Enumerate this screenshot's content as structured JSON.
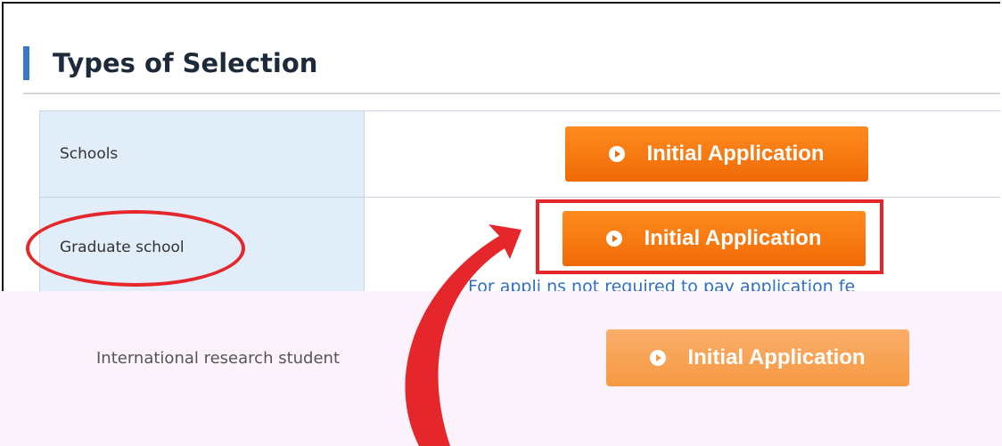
{
  "section": {
    "title": "Types of Selection"
  },
  "rows": [
    {
      "label": "Schools",
      "button": "Initial Application"
    },
    {
      "label": "Graduate school",
      "button": "Initial Application",
      "note": "For appli",
      "note_rest": "ns not required to pay application fe"
    }
  ],
  "overlay": {
    "label": "International research student",
    "button": "Initial Application"
  },
  "colors": {
    "accent": "#f06a06",
    "highlight": "#e5262a",
    "label_bg": "#e1edf9",
    "overlay_bg": "#fcf2fb"
  },
  "icons": {
    "button_icon": "play-circle-icon",
    "note_icon": "bullet-icon"
  }
}
